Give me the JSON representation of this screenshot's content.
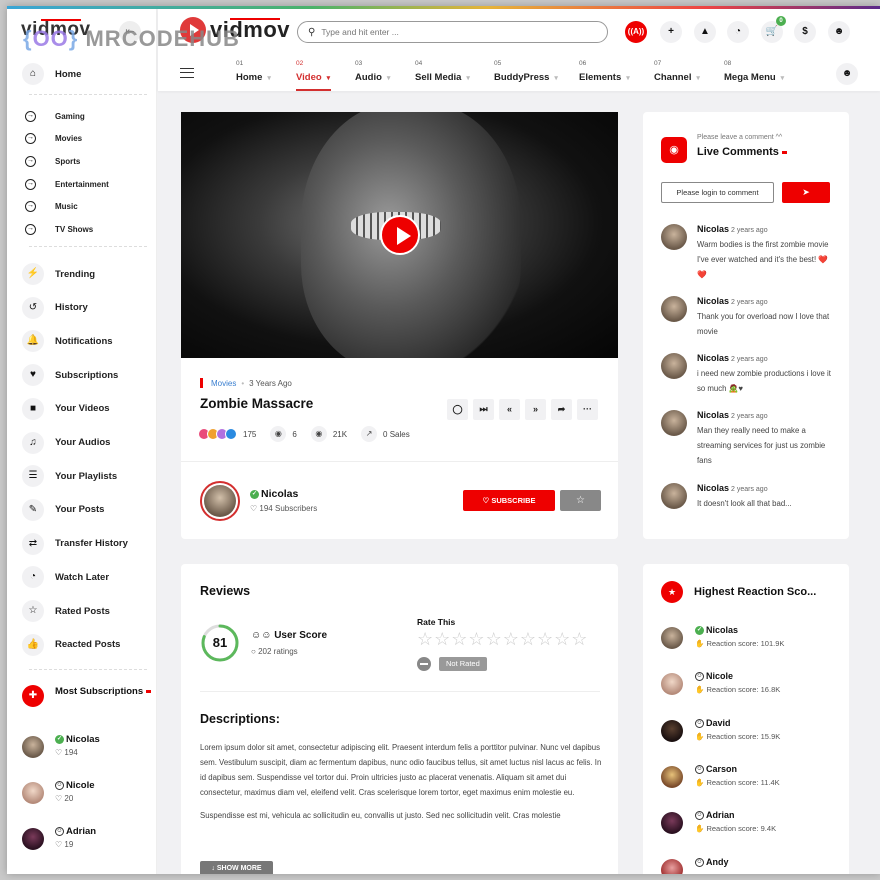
{
  "watermark": "MRCODEHUB",
  "sidebar": {
    "logo": "vidmov",
    "home_label": "Home",
    "categories": [
      "Gaming",
      "Movies",
      "Sports",
      "Entertainment",
      "Music",
      "TV Shows"
    ],
    "items": [
      {
        "label": "Trending",
        "icon": "bolt-icon",
        "glyph": "⚡"
      },
      {
        "label": "History",
        "icon": "history-icon",
        "glyph": "↺"
      },
      {
        "label": "Notifications",
        "icon": "bell-icon",
        "glyph": "🔔"
      },
      {
        "label": "Subscriptions",
        "icon": "heart-icon",
        "glyph": "♥"
      },
      {
        "label": "Your Videos",
        "icon": "video-camera-icon",
        "glyph": "■"
      },
      {
        "label": "Your Audios",
        "icon": "music-note-icon",
        "glyph": "♫"
      },
      {
        "label": "Your Playlists",
        "icon": "list-icon",
        "glyph": "☰"
      },
      {
        "label": "Your Posts",
        "icon": "posts-icon",
        "glyph": "✎"
      },
      {
        "label": "Transfer History",
        "icon": "transfer-icon",
        "glyph": "⇄"
      },
      {
        "label": "Watch Later",
        "icon": "clock-icon",
        "glyph": "◔"
      },
      {
        "label": "Rated Posts",
        "icon": "star-icon",
        "glyph": "☆"
      },
      {
        "label": "Reacted Posts",
        "icon": "thumbs-up-icon",
        "glyph": "👍"
      }
    ],
    "most_subscriptions": {
      "title": "Most Subscriptions",
      "users": [
        {
          "name": "Nicolas",
          "count": "194",
          "verified": true
        },
        {
          "name": "Nicole",
          "count": "20",
          "verified": false
        },
        {
          "name": "Adrian",
          "count": "19",
          "verified": false
        }
      ]
    }
  },
  "header": {
    "logo": "vidmov",
    "search_placeholder": "Type and hit enter ...",
    "cart_count": "0",
    "nav": [
      {
        "num": "01",
        "label": "Home",
        "active": false
      },
      {
        "num": "02",
        "label": "Video",
        "active": true
      },
      {
        "num": "03",
        "label": "Audio",
        "active": false
      },
      {
        "num": "04",
        "label": "Sell Media",
        "active": false
      },
      {
        "num": "05",
        "label": "BuddyPress",
        "active": false
      },
      {
        "num": "06",
        "label": "Elements",
        "active": false
      },
      {
        "num": "07",
        "label": "Channel",
        "active": false
      },
      {
        "num": "08",
        "label": "Mega Menu",
        "active": false
      }
    ]
  },
  "video": {
    "category": "Movies",
    "time_ago": "3 Years Ago",
    "title": "Zombie Massacre",
    "reactions_count": "175",
    "comments_count": "6",
    "views": "21K",
    "sales": "0 Sales",
    "channel": {
      "name": "Nicolas",
      "subscribers": "194 Subscribers",
      "verified": true
    },
    "subscribe_label": "SUBSCRIBE"
  },
  "reviews": {
    "title": "Reviews",
    "user_score": 81,
    "user_score_label": "User Score",
    "ratings": "202 ratings",
    "rate_this": "Rate This",
    "stars_total": 10,
    "stars_filled": 0,
    "not_rated": "Not Rated"
  },
  "descriptions": {
    "title": "Descriptions:",
    "paragraphs": [
      "Lorem ipsum dolor sit amet, consectetur adipiscing elit. Praesent interdum felis a porttitor pulvinar. Nunc vel dapibus sem. Vestibulum suscipit, diam ac fermentum dapibus, nunc odio faucibus tellus, sit amet luctus nisl lacus ac felis. In id dapibus sem. Suspendisse vel tortor dui. Proin ultricies justo ac placerat venenatis. Aliquam sit amet dui consectetur, maximus diam vel, eleifend velit. Cras scelerisque lorem tortor, eget maximus enim molestie eu.",
      "Suspendisse est mi, vehicula ac sollicitudin eu, convallis ut justo. Sed nec sollicitudin velit. Cras molestie"
    ],
    "show_more": "SHOW MORE"
  },
  "live_comments": {
    "subtitle": "Please leave a comment ^^",
    "title": "Live Comments",
    "login_prompt": "Please login to comment",
    "comments": [
      {
        "name": "Nicolas",
        "ago": "2 years ago",
        "text": "Warm bodies is the first zombie movie I've ever watched and it's the best! ❤️ ❤️"
      },
      {
        "name": "Nicolas",
        "ago": "2 years ago",
        "text": "Thank you for overload now I love that movie"
      },
      {
        "name": "Nicolas",
        "ago": "2 years ago",
        "text": "i need new zombie productions i love it so much 🧟♥"
      },
      {
        "name": "Nicolas",
        "ago": "2 years ago",
        "text": "Man they really need to make a streaming services for just us zombie fans"
      },
      {
        "name": "Nicolas",
        "ago": "2 years ago",
        "text": "It doesn't look all that bad..."
      }
    ]
  },
  "highest_reaction": {
    "title": "Highest Reaction Sco...",
    "score_label": "Reaction score:",
    "users": [
      {
        "name": "Nicolas",
        "score": "101.9K",
        "verified": true
      },
      {
        "name": "Nicole",
        "score": "16.8K",
        "verified": false
      },
      {
        "name": "David",
        "score": "15.9K",
        "verified": false
      },
      {
        "name": "Carson",
        "score": "11.4K",
        "verified": false
      },
      {
        "name": "Adrian",
        "score": "9.4K",
        "verified": false
      },
      {
        "name": "Andy",
        "score": "",
        "verified": false
      }
    ]
  },
  "colors": {
    "accent": "#e00000",
    "verified": "#4caf50",
    "link": "#3a7fd0",
    "score_ring": "#5cb85c"
  }
}
